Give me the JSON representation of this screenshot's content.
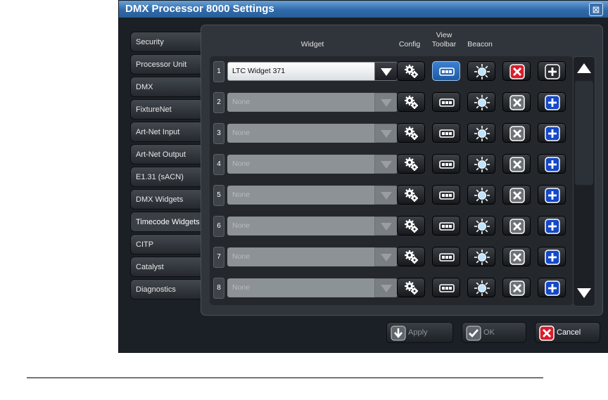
{
  "window": {
    "title": "DMX Processor 8000 Settings"
  },
  "sidebar": {
    "active_index": 8,
    "items": [
      {
        "label": "Security"
      },
      {
        "label": "Processor Unit"
      },
      {
        "label": "DMX"
      },
      {
        "label": "FixtureNet"
      },
      {
        "label": "Art-Net Input"
      },
      {
        "label": "Art-Net Output"
      },
      {
        "label": "E1.31 (sACN)"
      },
      {
        "label": "DMX Widgets"
      },
      {
        "label": "Timecode Widgets"
      },
      {
        "label": "CITP"
      },
      {
        "label": "Catalyst"
      },
      {
        "label": "Diagnostics"
      }
    ]
  },
  "columns": {
    "widget": "Widget",
    "config": "Config",
    "view_toolbar": "View Toolbar",
    "view_toolbar_line1": "View",
    "view_toolbar_line2": "Toolbar",
    "beacon": "Beacon"
  },
  "rows": [
    {
      "num": "1",
      "widget": "LTC Widget 371",
      "assigned": true
    },
    {
      "num": "2",
      "widget": "None",
      "assigned": false
    },
    {
      "num": "3",
      "widget": "None",
      "assigned": false
    },
    {
      "num": "4",
      "widget": "None",
      "assigned": false
    },
    {
      "num": "5",
      "widget": "None",
      "assigned": false
    },
    {
      "num": "6",
      "widget": "None",
      "assigned": false
    },
    {
      "num": "7",
      "widget": "None",
      "assigned": false
    },
    {
      "num": "8",
      "widget": "None",
      "assigned": false
    }
  ],
  "footer": {
    "apply": "Apply",
    "ok": "OK",
    "cancel": "Cancel"
  },
  "colors": {
    "title_bar": "#2f6aaa",
    "remove_active": "#d81e2c",
    "add_blue": "#1448c8"
  }
}
